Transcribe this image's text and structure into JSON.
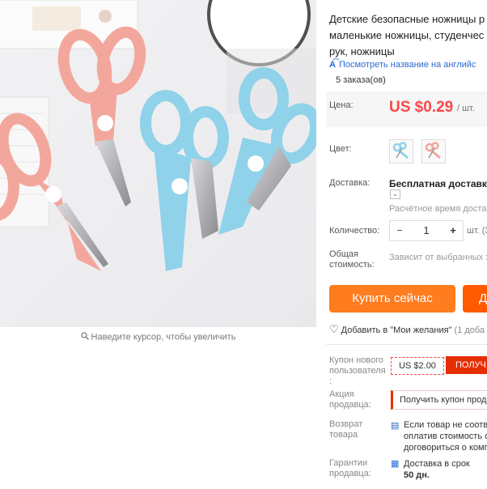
{
  "product": {
    "title_lines": [
      "Детские безопасные ножницы р",
      "маленькие ножницы, студенчес",
      "рук, ножницы"
    ],
    "translate_link": "Посмотреть название на английс",
    "orders": "5 заказа(ов)"
  },
  "price": {
    "label": "Цена:",
    "value": "US $0.29",
    "unit": "/ шт."
  },
  "color": {
    "label": "Цвет:",
    "swatches": [
      "blue-scissors",
      "pink-scissors"
    ]
  },
  "shipping": {
    "label": "Доставка:",
    "value": "Бесплатная доставка в",
    "note": "Расчётное время достав"
  },
  "quantity": {
    "label": "Количество:",
    "minus": "−",
    "value": "1",
    "plus": "+",
    "unit": "шт. (3"
  },
  "total": {
    "label_line1": "Общая",
    "label_line2": "стоимость:",
    "value": "Зависит от выбранных х"
  },
  "buttons": {
    "buy_now": "Купить сейчас",
    "add_to_cart": "Д"
  },
  "wishlist": {
    "label": "Добавить в \"Мои желания\"",
    "count": "(1 доба"
  },
  "coupon_new": {
    "label_lines": [
      "Купон нового",
      "пользователя",
      ":"
    ],
    "amount": "US $2.00",
    "action": "ПОЛУЧ"
  },
  "seller_coupon": {
    "label_lines": [
      "Акция",
      "продавца:"
    ],
    "action": "Получить купон прод"
  },
  "returns": {
    "label_lines": [
      "Возврат",
      "товара"
    ],
    "text_lines": [
      "Если товар не соотве",
      "оплатив стоимость о",
      "договориться о комп"
    ]
  },
  "guarantee": {
    "label_lines": [
      "Гарантии",
      "продавца:"
    ],
    "text_line1": "Доставка в срок",
    "text_line2": "50 дн."
  },
  "image": {
    "zoom_hint": "Наведите курсор, чтобы увеличить"
  },
  "colors": {
    "price": "#ff4747",
    "buy_button": "#ff7c1f",
    "cart_button": "#ff5a00",
    "coupon_red": "#e62e04",
    "link_blue": "#2a6acb",
    "scissors_pink": "#f3a79c",
    "scissors_blue": "#8fd2ea"
  }
}
